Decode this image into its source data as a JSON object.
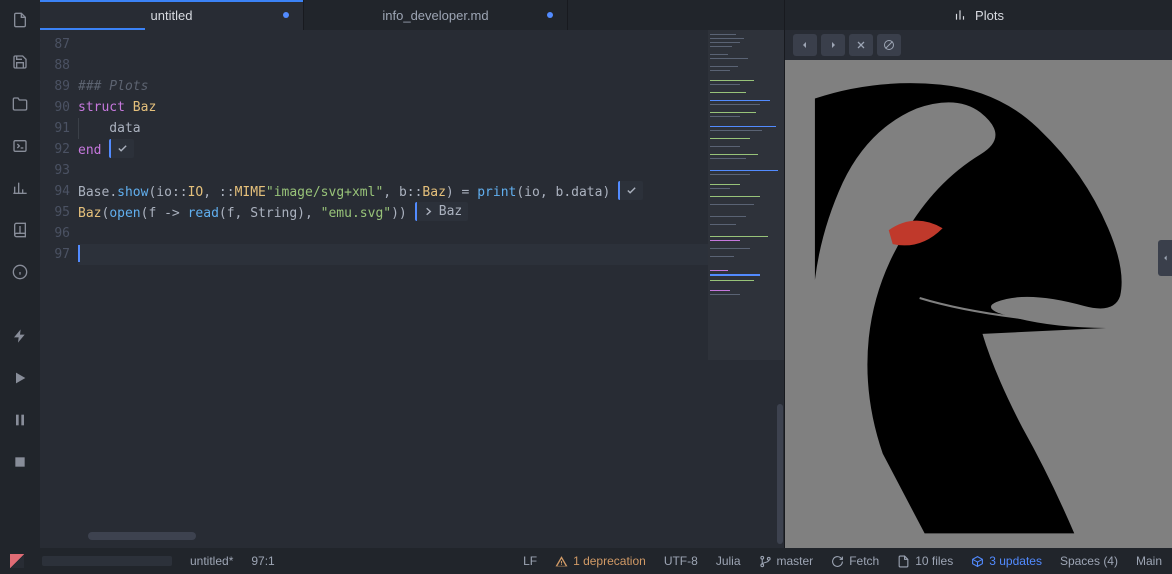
{
  "tabs": [
    {
      "title": "untitled",
      "modified": true
    },
    {
      "title": "info_developer.md",
      "modified": true
    }
  ],
  "plots_panel": {
    "title": "Plots"
  },
  "gutter": [
    "87",
    "88",
    "89",
    "90",
    "91",
    "92",
    "93",
    "94",
    "95",
    "96",
    "97"
  ],
  "code": {
    "l89": "### Plots",
    "l90a": "struct",
    "l90b": " Baz",
    "l91": "    data",
    "l92": "end",
    "l94_base": "Base",
    "l94_show": "show",
    "l94_io": "io",
    "l94_IOt": "IO",
    "l94_mime": "MIME",
    "l94_str": "\"image/svg+xml\"",
    "l94_b": "b",
    "l94_Baz": "Baz",
    "l94_print": "print",
    "l94_rest": "(io, b.data)",
    "l95_Baz": "Baz",
    "l95_open": "open",
    "l95_read": "read",
    "l95_str": "\"emu.svg\"",
    "l95_res": "Baz"
  },
  "status": {
    "filename": "untitled*",
    "cursor": "97:1",
    "lf": "LF",
    "deprecation": "1 deprecation",
    "encoding": "UTF-8",
    "lang": "Julia",
    "branch": "master",
    "fetch": "Fetch",
    "files": "10 files",
    "updates": "3 updates",
    "spaces": "Spaces (4)",
    "main": "Main"
  }
}
